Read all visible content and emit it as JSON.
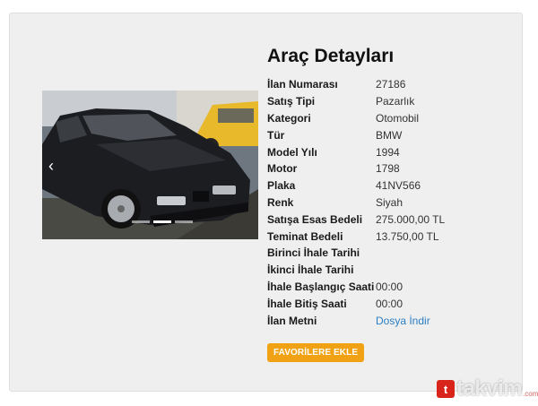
{
  "heading": "Araç Detayları",
  "details": [
    {
      "key": "İlan Numarası",
      "value": "27186"
    },
    {
      "key": "Satış Tipi",
      "value": "Pazarlık"
    },
    {
      "key": "Kategori",
      "value": "Otomobil"
    },
    {
      "key": "Tür",
      "value": "BMW"
    },
    {
      "key": "Model Yılı",
      "value": "1994"
    },
    {
      "key": "Motor",
      "value": "1798"
    },
    {
      "key": "Plaka",
      "value": "41NV566"
    },
    {
      "key": "Renk",
      "value": "Siyah"
    },
    {
      "key": "Satışa Esas Bedeli",
      "value": "275.000,00 TL"
    },
    {
      "key": "Teminat Bedeli",
      "value": "13.750,00 TL"
    },
    {
      "key": "Birinci İhale Tarihi",
      "value": ""
    },
    {
      "key": "İkinci İhale Tarihi",
      "value": ""
    },
    {
      "key": "İhale Başlangıç Saati",
      "value": "00:00"
    },
    {
      "key": "İhale Bitiş Saati",
      "value": "00:00"
    },
    {
      "key": "İlan Metni",
      "value": "Dosya İndir"
    }
  ],
  "favorite_button": "FAVORİLERE EKLE",
  "carousel": {
    "prev_icon": "chevron-left-icon",
    "slide_count": 3,
    "active_slide": 1
  },
  "watermark": {
    "brand": "takvim",
    "suffix": ".com.tr"
  },
  "colors": {
    "accent": "#f0a214",
    "link": "#2a7fc4",
    "panel": "#efefef"
  }
}
